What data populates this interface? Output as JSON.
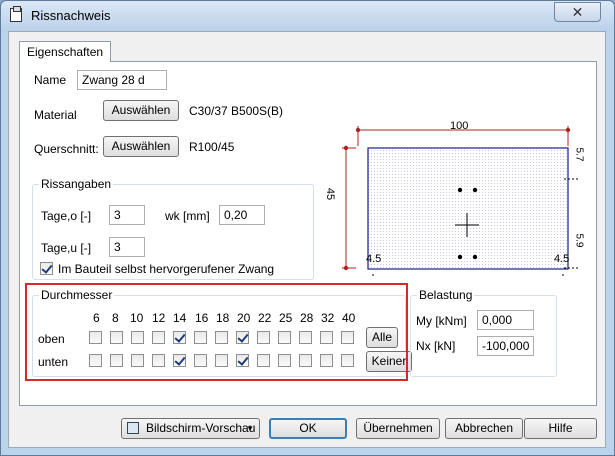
{
  "window": {
    "title": "Rissnachweis",
    "close_label": "✕"
  },
  "tabs": [
    {
      "label": "Eigenschaften"
    }
  ],
  "form": {
    "name_label": "Name",
    "name_value": "Zwang 28 d",
    "material_label": "Material",
    "material_button": "Auswählen",
    "material_value": "C30/37 B500S(B)",
    "querschnitt_label": "Querschnitt:",
    "querschnitt_button": "Auswählen",
    "querschnitt_value": "R100/45"
  },
  "rissangaben": {
    "title": "Rissangaben",
    "tage_o_label": "Tage,o [-]",
    "tage_o_value": "3",
    "wk_label": "wk [mm]",
    "wk_value": "0,20",
    "tage_u_label": "Tage,u [-]",
    "tage_u_value": "3",
    "checkbox_label": "Im Bauteil selbst hervorgerufener Zwang",
    "checkbox_checked": true
  },
  "durchmesser": {
    "title": "Durchmesser",
    "diameters": [
      "6",
      "8",
      "10",
      "12",
      "14",
      "16",
      "18",
      "20",
      "22",
      "25",
      "28",
      "32",
      "40"
    ],
    "row_oben_label": "oben",
    "row_unten_label": "unten",
    "oben_checked": [
      false,
      false,
      false,
      false,
      true,
      false,
      false,
      true,
      false,
      false,
      false,
      false,
      false
    ],
    "unten_checked": [
      false,
      false,
      false,
      false,
      true,
      false,
      false,
      true,
      false,
      false,
      false,
      false,
      false
    ],
    "alle_button": "Alle",
    "keiner_button": "Keiner"
  },
  "belastung": {
    "title": "Belastung",
    "my_label": "My [kNm]",
    "my_value": "0,000",
    "nx_label": "Nx [kN]",
    "nx_value": "-100,000"
  },
  "diagram": {
    "width_label": "100",
    "height_label": "45",
    "top_right_label": "5.7",
    "bottom_right_label": "5.9",
    "bottom_left_label": "4.5",
    "bottom_right_x_label": "4.5",
    "accent_color": "#b02020",
    "outline_color": "#1a1a8c"
  },
  "footer": {
    "preview_button": "Bildschirm-Vorschau",
    "ok_button": "OK",
    "apply_button": "Übernehmen",
    "cancel_button": "Abbrechen",
    "help_button": "Hilfe"
  }
}
